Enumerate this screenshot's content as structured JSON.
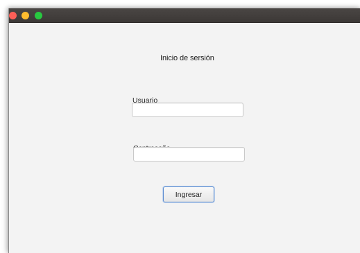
{
  "window": {
    "controls": [
      "close-button",
      "minimize-button",
      "maximize-button"
    ]
  },
  "login": {
    "title": "Inicio de sersión",
    "username_label": "Usuario",
    "username_value": "",
    "password_label": "Ccntraseña",
    "password_value": "",
    "submit_label": "Ingresar"
  },
  "colors": {
    "titlebar": "#3f3b39",
    "close": "#fe5f57",
    "minimize": "#febc2e",
    "maximize": "#28c840",
    "window_bg": "#f3f3f3",
    "button_focus": "#5a8bd0"
  }
}
